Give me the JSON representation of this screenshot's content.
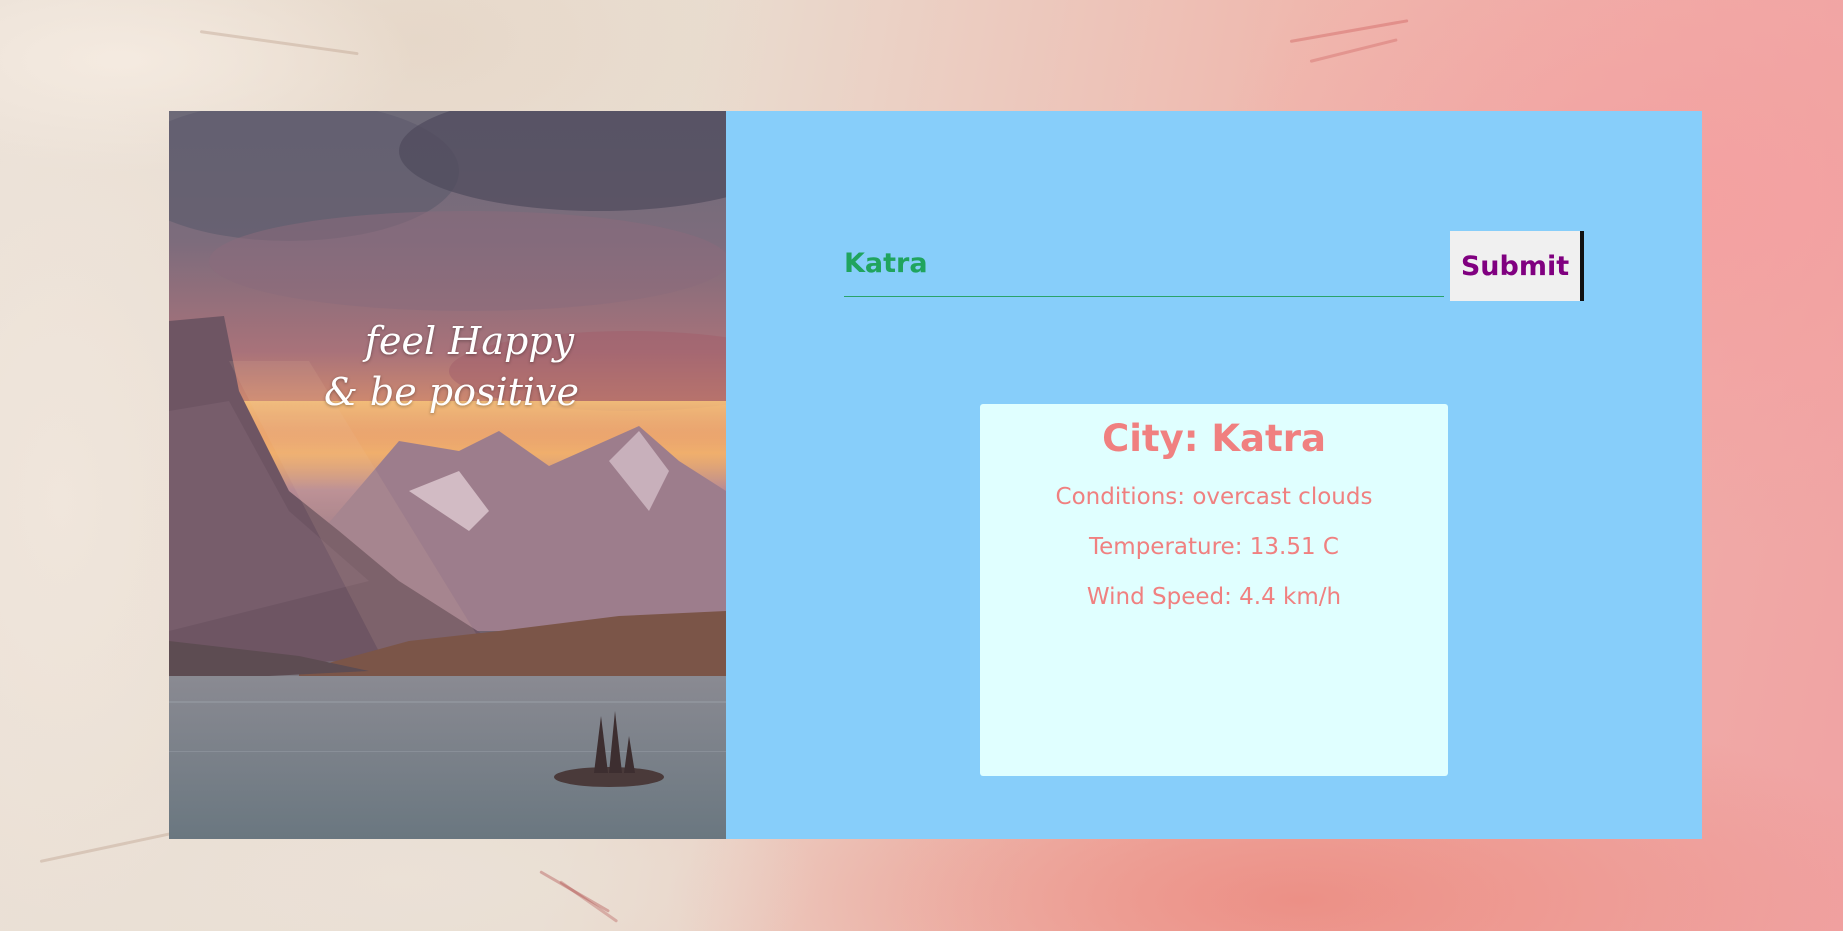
{
  "colors": {
    "panel_bg": "#87cefa",
    "result_bg": "#e0ffff",
    "result_text": "#f08080",
    "input_text": "#20a45e",
    "button_text": "#800080"
  },
  "hero": {
    "quote_line_1": "feel Happy",
    "quote_line_2": "& be positive"
  },
  "search": {
    "value": "Katra",
    "placeholder": "",
    "submit_label": "Submit"
  },
  "weather": {
    "city": "City: Katra",
    "conditions": "Conditions: overcast clouds",
    "temperature": "Temperature: 13.51 C",
    "wind_speed": "Wind Speed: 4.4 km/h"
  }
}
